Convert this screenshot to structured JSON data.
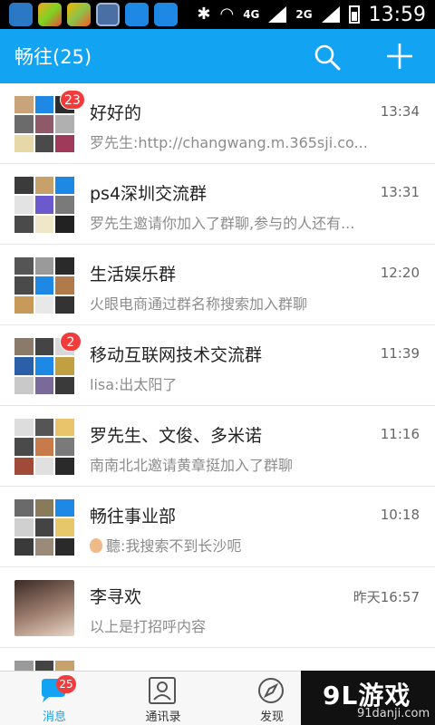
{
  "status": {
    "time": "13:59",
    "net1": "4G",
    "net2": "2G"
  },
  "header": {
    "title": "畅往(25)"
  },
  "chats": [
    {
      "name": "好好的",
      "preview": "罗先生:http://changwang.m.365sji.co...",
      "time": "13:34",
      "badge": "23"
    },
    {
      "name": "ps4深圳交流群",
      "preview": "罗先生邀请你加入了群聊,参与的人还有...",
      "time": "13:31",
      "badge": ""
    },
    {
      "name": "生活娱乐群",
      "preview": "火眼电商通过群名称搜索加入群聊",
      "time": "12:20",
      "badge": ""
    },
    {
      "name": "移动互联网技术交流群",
      "preview": "lisa:出太阳了",
      "time": "11:39",
      "badge": "2"
    },
    {
      "name": "罗先生、文俊、多米诺",
      "preview": "南南北北邀请黄章挺加入了群聊",
      "time": "11:16",
      "badge": ""
    },
    {
      "name": "畅往事业部",
      "preview": "聽:我搜索不到长沙呃",
      "time": "10:18",
      "badge": ""
    },
    {
      "name": "李寻欢",
      "preview": "以上是打招呼内容",
      "time": "昨天16:57",
      "badge": ""
    }
  ],
  "nav": {
    "messages": {
      "label": "消息",
      "badge": "25"
    },
    "contacts": {
      "label": "通讯录"
    },
    "discover": {
      "label": "发现"
    }
  },
  "brand": {
    "main": "9L游戏",
    "sub": "91danji.com"
  },
  "colors": {
    "accent": "#12a4f2",
    "badge": "#f23b3b"
  }
}
